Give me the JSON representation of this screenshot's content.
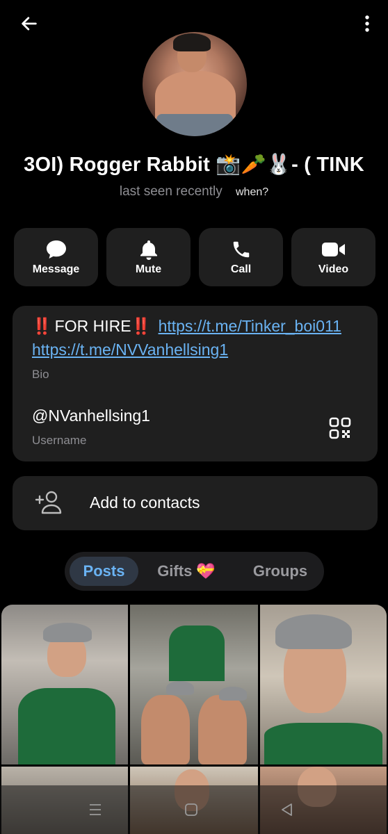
{
  "header": {
    "back_icon": "arrow-left-icon",
    "menu_icon": "more-vertical-icon"
  },
  "profile": {
    "name": "3OI)    Rogger Rabbit 📸🥕🐰- ( TINK",
    "status": "last seen recently",
    "when_label": "when?"
  },
  "actions": [
    {
      "label": "Message",
      "icon": "chat-bubble-icon"
    },
    {
      "label": "Mute",
      "icon": "bell-icon"
    },
    {
      "label": "Call",
      "icon": "phone-icon"
    },
    {
      "label": "Video",
      "icon": "video-camera-icon"
    }
  ],
  "info": {
    "bio_prefix_mark": "‼️",
    "bio_text": "FOR HIRE",
    "bio_suffix_mark": "‼️",
    "bio_link1": "https://t.me/Tinker_boi011",
    "bio_link2": "https://t.me/NVVanhellsing1",
    "bio_label": "Bio",
    "username": "@NVanhellsing1",
    "username_label": "Username",
    "qr_icon": "qr-code-icon"
  },
  "add_contact": {
    "label": "Add to contacts",
    "icon": "add-person-icon"
  },
  "tabs": [
    {
      "label": "Posts",
      "active": true
    },
    {
      "label": "Gifts 💝",
      "active": false
    },
    {
      "label": "Groups",
      "active": false
    }
  ],
  "colors": {
    "accent": "#6ab3f3",
    "card_bg": "#1f1f1f",
    "background": "#000000",
    "secondary_text": "#8e8e93"
  },
  "nav": {
    "recent_icon": "recent-apps-icon",
    "home_icon": "home-icon",
    "back_icon": "nav-back-icon"
  }
}
